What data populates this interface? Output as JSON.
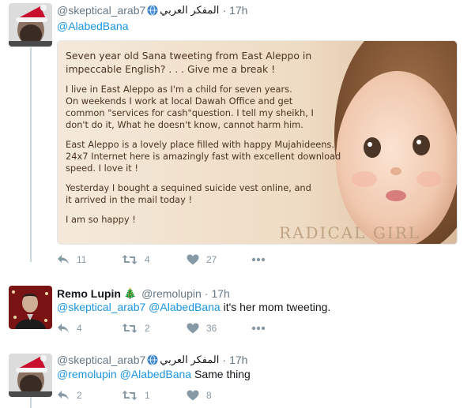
{
  "tweets": [
    {
      "handle": "@skeptical_arab7",
      "arabic_name": "المفكر العربي",
      "dot": "·",
      "time": "17h",
      "mention1": "@AlabedBana",
      "image": {
        "title_line1": "Seven year old Sana tweeting from East Aleppo in",
        "title_line2": "impeccable English? . . . Give me a break !",
        "p1_line1": "I live in East Aleppo as I'm a child for seven years.",
        "p1_line2": "On weekends I work at local Dawah Office and get",
        "p1_line3": "common \"services for cash\"question. I tell my sheikh, I",
        "p1_line4": "don't do it, What he doesn't know, cannot harm him.",
        "p2_line1": "East Aleppo is a lovely place filled with happy Mujahideens.",
        "p2_line2": "24x7 Internet here is amazingly fast with excellent download",
        "p2_line3": "speed. I love it !",
        "p3_line1": "Yesterday I bought a sequined suicide vest online, and",
        "p3_line2": "it arrived in the mail today !",
        "p4_line1": "I am so happy !",
        "watermark": "RADICAL GIRL"
      },
      "reply_count": "11",
      "retweet_count": "4",
      "like_count": "27"
    },
    {
      "display_name": "Remo Lupin",
      "name_emoji": "🎄",
      "handle": "@remolupin",
      "dot": "·",
      "time": "17h",
      "mention1": "@skeptical_arab7",
      "mention2": "@AlabedBana",
      "text": "it's her mom tweeting.",
      "reply_count": "4",
      "retweet_count": "2",
      "like_count": "36"
    },
    {
      "handle": "@skeptical_arab7",
      "arabic_name": "المفكر العربي",
      "dot": "·",
      "time": "17h",
      "mention1": "@remolupin",
      "mention2": "@AlabedBana",
      "text": "Same thing",
      "reply_count": "2",
      "retweet_count": "1",
      "like_count": "8"
    }
  ],
  "colors": {
    "link": "#1b95e0",
    "secondary": "#657786",
    "action": "#8899a6",
    "thread_line": "#ccd6dd"
  },
  "icons": [
    "reply-icon",
    "retweet-icon",
    "like-icon",
    "more-icon",
    "globe-icon"
  ]
}
